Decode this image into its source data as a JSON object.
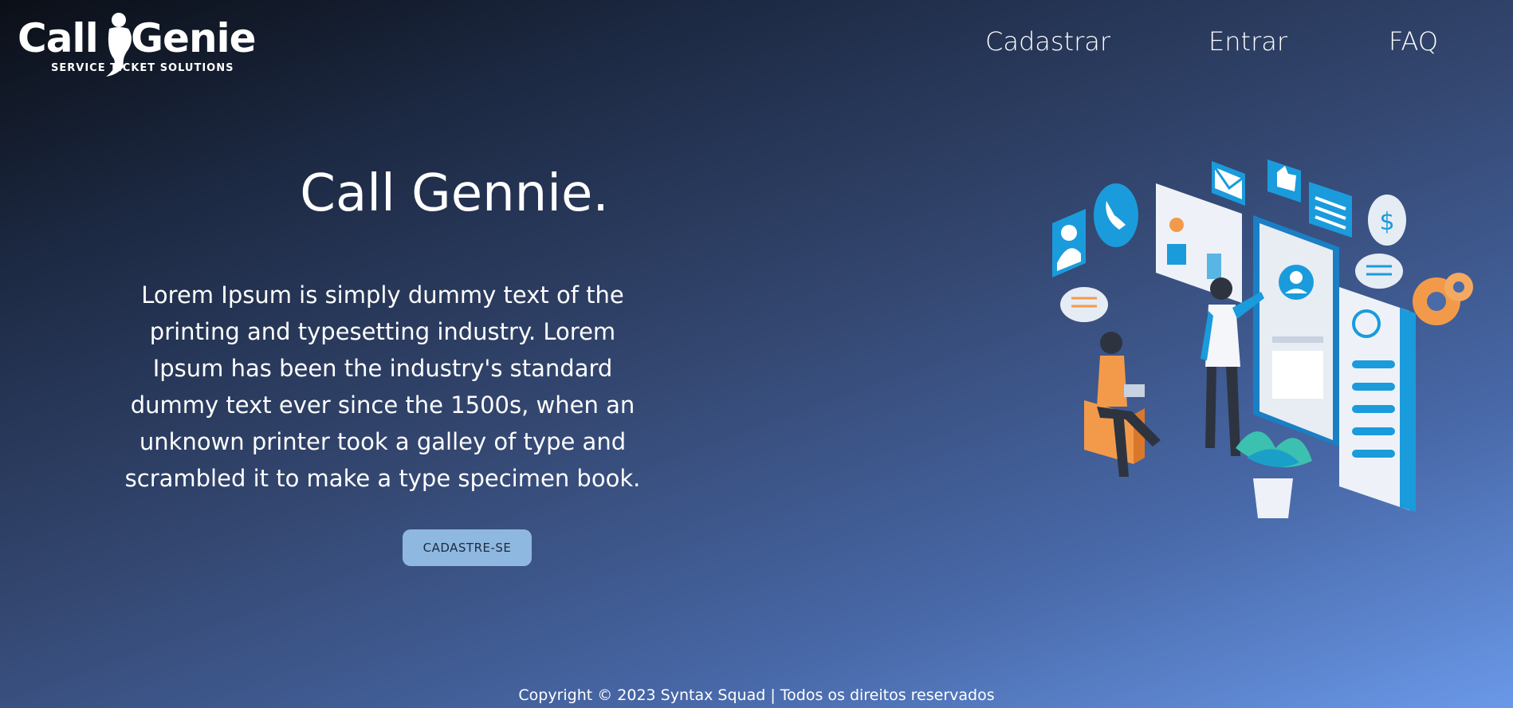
{
  "header": {
    "logo": {
      "word1": "Call",
      "word2": "Genie",
      "tagline": "SERVICE TICKET SOLUTIONS"
    },
    "nav": [
      {
        "label": "Cadastrar"
      },
      {
        "label": "Entrar"
      },
      {
        "label": "FAQ"
      }
    ]
  },
  "hero": {
    "title": "Call Gennie.",
    "text": "Lorem Ipsum is simply dummy text of the printing and typesetting industry. Lorem Ipsum has been the industry's standard dummy text ever since the 1500s, when an unknown printer took a galley of type and scrambled it to make a type specimen book.",
    "cta_label": "CADASTRE-SE",
    "illustration": "customer-service-app-illustration"
  },
  "footer": {
    "text": "Copyright © 2023 Syntax Squad | Todos os direitos reservados"
  },
  "colors": {
    "background_start": "#0b0f17",
    "background_end": "#6a98e8",
    "button": "#8fb8e0",
    "accent_blue": "#1a9bdc",
    "accent_orange": "#f39a4a"
  }
}
